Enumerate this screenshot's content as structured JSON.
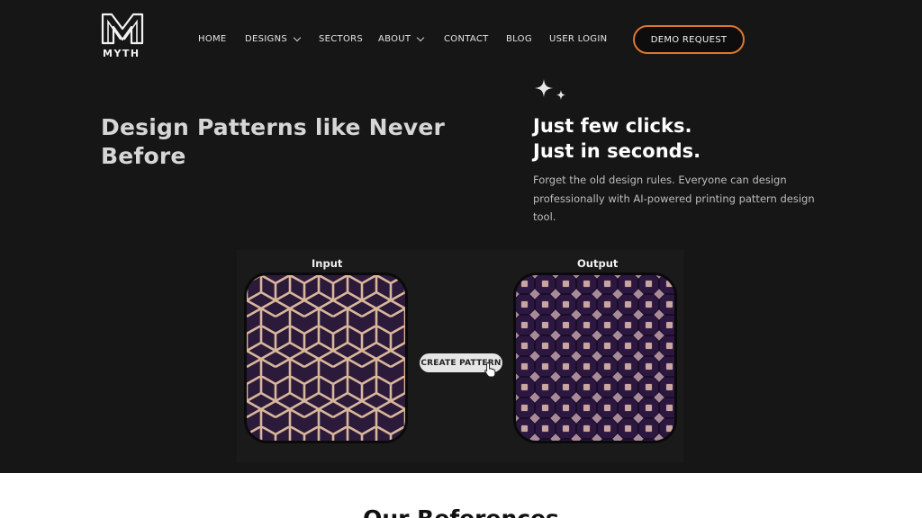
{
  "brand": {
    "name": "MYTH"
  },
  "nav": {
    "items": [
      {
        "label": "HOME",
        "has_dropdown": false
      },
      {
        "label": "DESIGNS",
        "has_dropdown": true
      },
      {
        "label": "SECTORS",
        "has_dropdown": false
      },
      {
        "label": "ABOUT",
        "has_dropdown": true
      },
      {
        "label": "CONTACT",
        "has_dropdown": false
      },
      {
        "label": "BLOG",
        "has_dropdown": false
      },
      {
        "label": "USER LOGIN",
        "has_dropdown": false
      }
    ],
    "cta_label": "DEMO REQUEST"
  },
  "hero": {
    "headline_line1": "Design Patterns like Never",
    "headline_line2": "Before",
    "tagline_line1": "Just few clicks.",
    "tagline_line2": "Just in seconds.",
    "description": "Forget the old design rules. Everyone can design professionally with AI-powered printing pattern design tool."
  },
  "demo": {
    "input_label": "Input",
    "output_label": "Output",
    "create_label": "CREATE PATTERN"
  },
  "references": {
    "title": "Our References"
  },
  "colors": {
    "background": "#161616",
    "accent": "#e0772c",
    "pattern_line": "#d9b79b",
    "pattern_fill": "#2c1a3a"
  }
}
